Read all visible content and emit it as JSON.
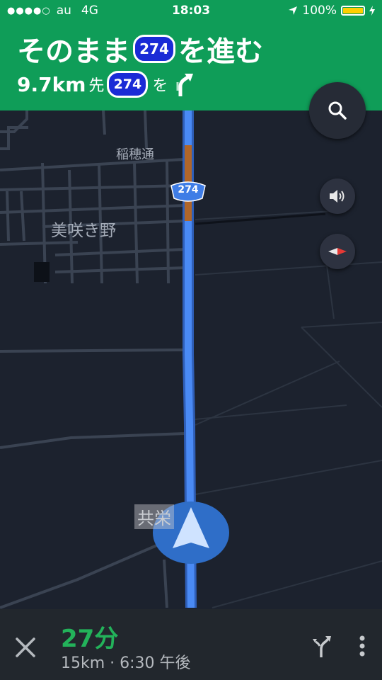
{
  "status_bar": {
    "carrier": "au",
    "network": "4G",
    "time": "18:03",
    "battery": "100%"
  },
  "nav_header": {
    "instruction_prefix": "そのまま",
    "route_number": "274",
    "instruction_suffix": "を進む",
    "distance": "9.7km",
    "distance_suffix": "先",
    "sub_route_number": "274",
    "sub_particle": "を"
  },
  "map": {
    "place_labels": {
      "street": "稲穂通",
      "district": "美咲き野",
      "junction": "共栄"
    },
    "route_shield": "274"
  },
  "bottom_bar": {
    "eta_minutes": "27分",
    "details": "15km · 6:30 午後"
  },
  "colors": {
    "header_green": "#0f9d58",
    "route_blue": "#4285f4",
    "traffic_brown": "#b0662a",
    "map_bg": "#1c222e",
    "eta_green": "#23b25a"
  },
  "icons": {
    "search": "search-icon",
    "sound": "volume-icon",
    "compass": "compass-icon",
    "close": "close-icon",
    "routes": "alt-routes-icon",
    "more": "more-vert-icon",
    "location": "navigation-arrow-icon",
    "turn": "keep-right-arrow-icon"
  }
}
